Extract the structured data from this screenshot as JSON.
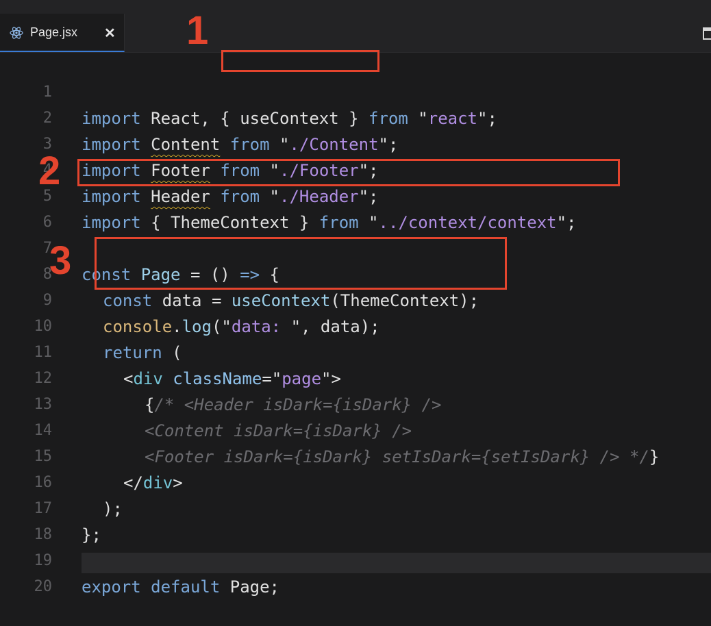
{
  "tab": {
    "label": "Page.jsx",
    "close": "✕",
    "icon": "react-icon"
  },
  "editor": {
    "lines": [
      {
        "n": "1"
      },
      {
        "n": "2"
      },
      {
        "n": "3"
      },
      {
        "n": "4"
      },
      {
        "n": "5"
      },
      {
        "n": "6"
      },
      {
        "n": "7"
      },
      {
        "n": "8"
      },
      {
        "n": "9"
      },
      {
        "n": "10"
      },
      {
        "n": "11"
      },
      {
        "n": "12"
      },
      {
        "n": "13"
      },
      {
        "n": "14"
      },
      {
        "n": "15"
      },
      {
        "n": "16"
      },
      {
        "n": "17"
      },
      {
        "n": "18"
      },
      {
        "n": "19"
      },
      {
        "n": "20"
      }
    ],
    "code": {
      "l1": [
        "import",
        " React, ",
        "{ useContext }",
        " ",
        "from",
        " \"",
        "react",
        "\";"
      ],
      "l2": [
        "import",
        " ",
        "Content",
        " ",
        "from",
        " \"",
        "./Content",
        "\";"
      ],
      "l3": [
        "import",
        " ",
        "Footer",
        " ",
        "from",
        " \"",
        "./Footer",
        "\";"
      ],
      "l4": [
        "import",
        " ",
        "Header",
        " ",
        "from",
        " \"",
        "./Header",
        "\";"
      ],
      "l5": [
        "import",
        " { ThemeContext } ",
        "from",
        " \"",
        "../context/context",
        "\";"
      ],
      "l7": [
        "const",
        " ",
        "Page",
        " = () ",
        "=>",
        " {"
      ],
      "l8": [
        "const",
        " data = ",
        "useContext",
        "(ThemeContext);"
      ],
      "l9": [
        "console",
        ".",
        "log",
        "(\"",
        "data: ",
        "\", data);"
      ],
      "l10": [
        "return",
        " ("
      ],
      "l11": [
        "<",
        "div",
        " ",
        "className",
        "=\"",
        "page",
        "\">"
      ],
      "l12": [
        "{",
        "/* <Header isDark={isDark} />"
      ],
      "l13": [
        "<Content isDark={isDark} />"
      ],
      "l14": [
        "<Footer isDark={isDark} setIsDark={setIsDark} /> */",
        "}"
      ],
      "l15": [
        "</",
        "div",
        ">"
      ],
      "l16": [
        ");"
      ],
      "l17": [
        "};"
      ],
      "l19": [
        "export",
        " ",
        "default",
        " Page;"
      ]
    }
  },
  "annotations": {
    "m1": "1",
    "m2": "2",
    "m3": "3"
  },
  "colors": {
    "annotation": "#e4452e",
    "keyword": "#7aa7d8",
    "string": "#b08ee2",
    "background": "#1b1b1c"
  }
}
